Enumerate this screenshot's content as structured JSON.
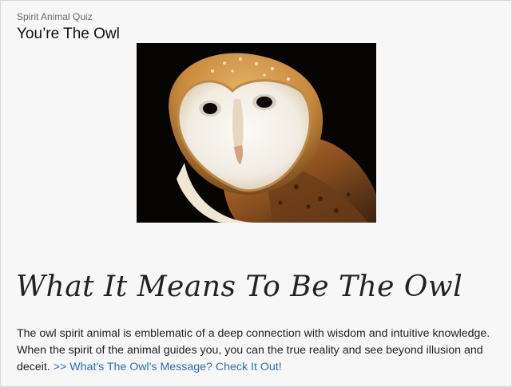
{
  "quiz": {
    "kicker": "Spirit Animal Quiz",
    "result_title": "You’re The Owl"
  },
  "image": {
    "subject": "barn owl photo"
  },
  "section": {
    "heading": "What It Means To Be The Owl",
    "body": "The owl spirit animal is emblematic of a deep connection with wisdom and intuitive knowledge. When the spirit of the animal guides you, you can the true reality and see beyond illusion and deceit.",
    "link_text": ">> What's The Owl's Message? Check It Out!"
  },
  "colors": {
    "background": "#f7f7f7",
    "link": "#2f6db3",
    "text": "#222222"
  }
}
